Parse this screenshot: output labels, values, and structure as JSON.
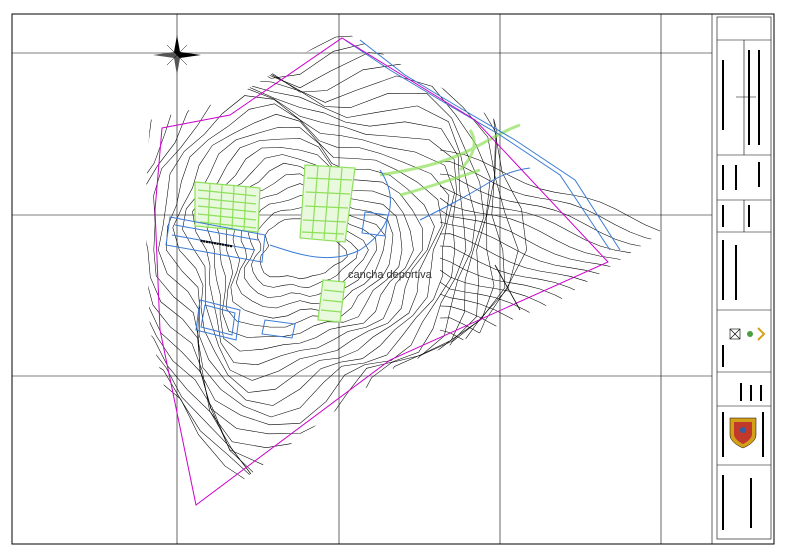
{
  "drawing": {
    "label": "cancha deportiva"
  },
  "colors": {
    "contour": "#000000",
    "boundary": "#cc00cc",
    "water": "#3a7bd5",
    "vegetation": "#8ee05a",
    "grid": "#000000",
    "background": "#ffffff"
  },
  "icons": [
    "north-arrow-icon",
    "municipal-shield-icon",
    "logo-icon"
  ]
}
